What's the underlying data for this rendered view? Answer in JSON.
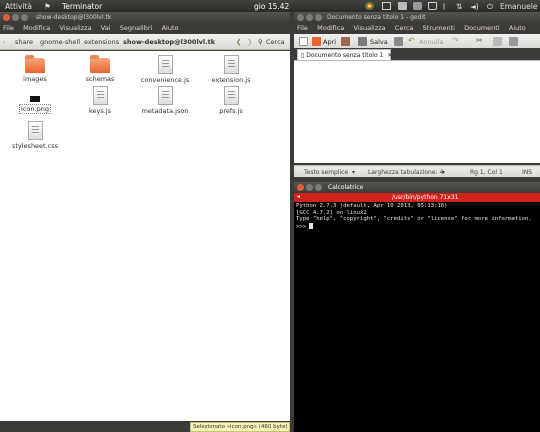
{
  "top_panel": {
    "activities": "Attività",
    "terminator": "Terminator",
    "clock": "gio 15.42",
    "user": "Emanuele"
  },
  "nautilus": {
    "title": "show-desktop@l300lvl.tk",
    "menus": [
      "File",
      "Modifica",
      "Visualizza",
      "Vai",
      "Segnalibri",
      "Aiuto"
    ],
    "breadcrumbs": [
      "share",
      "gnome-shell",
      "extensions",
      "show-desktop@l300lvl.tk"
    ],
    "search_label": "Cerca",
    "files": [
      {
        "name": "images",
        "kind": "folder"
      },
      {
        "name": "schemas",
        "kind": "folder"
      },
      {
        "name": "convenience.js",
        "kind": "doc"
      },
      {
        "name": "extension.js",
        "kind": "doc"
      },
      {
        "name": "icon.png",
        "kind": "png"
      },
      {
        "name": "keys.js",
        "kind": "doc"
      },
      {
        "name": "metadata.json",
        "kind": "doc"
      },
      {
        "name": "prefs.js",
        "kind": "doc"
      },
      {
        "name": "stylesheet.css",
        "kind": "doc"
      }
    ],
    "status": "Selezionato «icon.png» (460 byte)"
  },
  "gedit": {
    "title": "Documento senza titolo 1 - gedit",
    "menus": [
      "File",
      "Modifica",
      "Visualizza",
      "Cerca",
      "Strumenti",
      "Documenti",
      "Aiuto"
    ],
    "toolbar": {
      "open": "Apri",
      "save": "Salva",
      "undo": "Annulla"
    },
    "tab": "Documento senza titolo 1",
    "tab_close": "✕",
    "status": {
      "mode": "Testo semplice",
      "tab_width": "Larghezza tabulazione: 4",
      "position": "Rg 1, Col 1",
      "ins": "INS"
    }
  },
  "calculator": {
    "title": "Calcolatrice",
    "term_title": "/usr/bin/python 71x31",
    "lines": [
      "Python 2.7.3 (default, Apr 10 2013, 05:13:16)",
      "[GCC 4.7.2] on linux2",
      "Type \"help\", \"copyright\", \"credits\" or \"license\" for more information.",
      ">>> "
    ]
  },
  "colors": {
    "accent": "#e9642c",
    "term_bar": "#d0231e",
    "panel": "#3c3b37"
  }
}
